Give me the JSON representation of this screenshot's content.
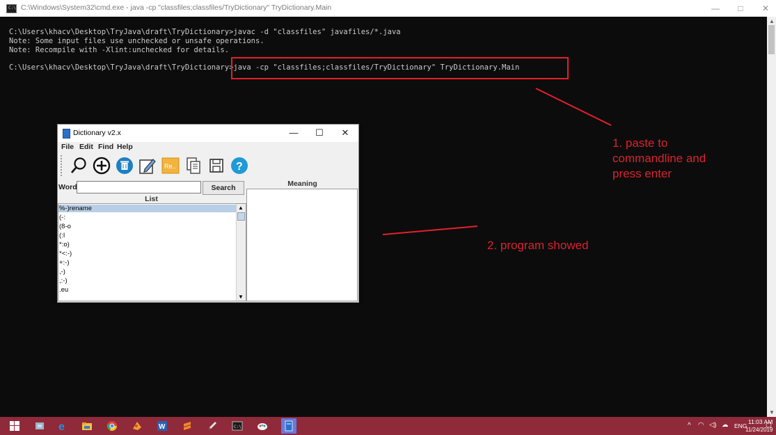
{
  "console_window": {
    "title": "C:\\Windows\\System32\\cmd.exe - java  -cp \"classfiles;classfiles/TryDictionary\" TryDictionary.Main",
    "controls": {
      "minimize": "—",
      "maximize": "□",
      "close": "✕"
    },
    "lines": [
      "C:\\Users\\khacv\\Desktop\\TryJava\\draft\\TryDictionary>javac -d \"classfiles\" javafiles/*.java",
      "Note: Some input files use unchecked or unsafe operations.",
      "Note: Recompile with -Xlint:unchecked for details.",
      "",
      "C:\\Users\\khacv\\Desktop\\TryJava\\draft\\TryDictionary>java -cp \"classfiles;classfiles/TryDictionary\" TryDictionary.Main"
    ]
  },
  "annotations": {
    "note_1": "1. paste to\ncommandline and\npress enter",
    "note_2": "2. program showed",
    "color": "#d9232e"
  },
  "dictionary_window": {
    "title": "Dictionary v2.x",
    "controls": {
      "minimize": "—",
      "maximize": "☐",
      "close": "✕"
    },
    "menu": [
      "File",
      "Edit",
      "Find",
      "Help"
    ],
    "toolbar_icons": [
      "search-icon",
      "add-icon",
      "delete-icon",
      "edit-icon",
      "rename-icon",
      "paste-icon",
      "save-icon",
      "help-icon"
    ],
    "rename_label": "Re..",
    "word_label": "Word",
    "word_value": "",
    "search_button": "Search",
    "list_header": "List",
    "meaning_header": "Meaning",
    "list_items": [
      "%-)rename",
      "(-:",
      "(8-o",
      "(:I",
      "*:o)",
      "*<:-)",
      "+:-)",
      ",-)",
      ",:-)",
      ".eu"
    ],
    "selected_index": 0
  },
  "taskbar": {
    "apps": [
      "windows-start-icon",
      "file-icon",
      "edge-icon",
      "explorer-icon",
      "chrome-icon",
      "paint-icon",
      "word-icon",
      "sublime-icon",
      "pen-icon",
      "cmd-icon",
      "paint3d-icon",
      "dictionary-icon"
    ],
    "tray": {
      "language": "ENG",
      "time": "11:03 AM",
      "date": "11/24/2019"
    },
    "color": "#8f2a3a"
  }
}
